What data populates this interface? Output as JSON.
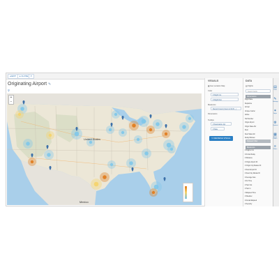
{
  "toolbar": {
    "buttons": [
      {
        "label": "◂ EDIT"
      },
      {
        "label": "▸ CLOSE"
      },
      {
        "label": "▾"
      }
    ]
  },
  "page": {
    "title": "Originating Airport",
    "title_icon": "✎",
    "subtitle_icon": "⚲"
  },
  "map": {
    "labels": {
      "country": "United States",
      "mexico": "Mexico"
    },
    "zoom": {
      "in": "+",
      "out": "−"
    },
    "clusters_colors": {
      "low": "#7ec6ea",
      "mid": "#f5d36a",
      "high": "#e07a1a"
    }
  },
  "visual_panel": {
    "header": "VISUALS",
    "type_label": "Geo Location Map",
    "section_label": "Color",
    "pills": [
      {
        "label": "# Flight Cnt"
      },
      {
        "label": "# Flight Dist"
      }
    ],
    "measures_label": "Measures",
    "measure_pill": "Record Count (Count of All R...)",
    "dimensions_label": "Dimensions",
    "tooltips_label": "Tooltips",
    "tooltip_pills": [
      {
        "label": "# Destination Apt"
      },
      {
        "label": "# Date"
      }
    ],
    "refresh_label": "↻ REFRESH VISUAL"
  },
  "data_panel": {
    "header": "DATA",
    "dataset_label": "Flights",
    "search_placeholder": "Search fields",
    "dimensions_header": "Dimensions",
    "dimensions": [
      "Flight Date",
      "Departure",
      "Arrival",
      "Unique Carrier",
      "Airline",
      "Tail Number",
      "Origin Airport",
      "Origin State Abr",
      "Dest",
      "Dest State Abr",
      "Delay Minutes"
    ],
    "filter_header": "Dataset Filter",
    "measures_header": "Measures",
    "measures": [
      "# Flights Cnt",
      "# Arrival Delay",
      "# Distance",
      "# Origin Airport ID",
      "# Origin City Market ID",
      "# Dest Airport ID",
      "# Dest City Market ID",
      "# Average Fare",
      "# Air Time",
      "# Taxi Out",
      "# Taxi In",
      "# Elapsed Time",
      "# Weather",
      "# Actual Elapsed",
      "# Security"
    ]
  },
  "rail": {
    "buttons": [
      {
        "icon": "▤",
        "label": "Data"
      },
      {
        "icon": "✎",
        "label": "Settings"
      },
      {
        "icon": "✶",
        "label": "Style"
      },
      {
        "icon": "⚙",
        "label": "Options"
      },
      {
        "icon": "▦",
        "label": "Show Filters"
      },
      {
        "icon": "≡",
        "label": "Filters"
      }
    ]
  }
}
